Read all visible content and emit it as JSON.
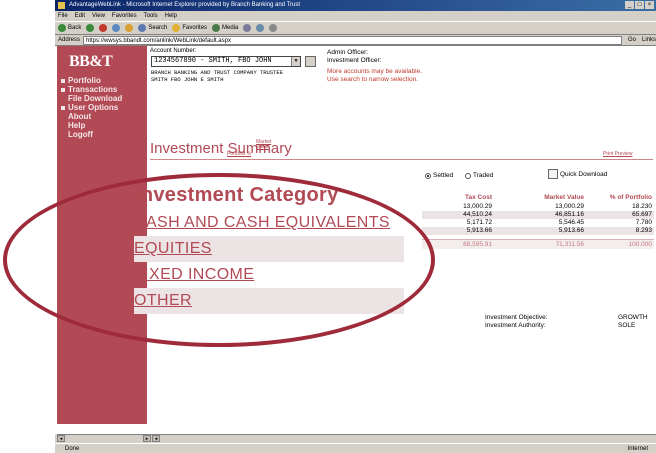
{
  "window": {
    "title": "AdvantageWebLink - Microsoft Internet Explorer provided by Branch Banking and Trust"
  },
  "menu": [
    "File",
    "Edit",
    "View",
    "Favorites",
    "Tools",
    "Help"
  ],
  "toolbar": {
    "back": "Back",
    "search": "Search",
    "favorites": "Favorites",
    "media": "Media"
  },
  "address": {
    "label": "Address",
    "url": "https://wwsys.bbandt.com/anlink/WebLink/default.aspx",
    "go": "Go",
    "links": "Links"
  },
  "sidebar": {
    "logo": "BB&T",
    "items": [
      {
        "label": "Portfolio",
        "bullet": true
      },
      {
        "label": "Transactions",
        "bullet": true
      },
      {
        "label": "File Download",
        "bullet": false
      },
      {
        "label": "User Options",
        "bullet": true
      },
      {
        "label": "About",
        "bullet": false
      },
      {
        "label": "Help",
        "bullet": false
      },
      {
        "label": "Logoff",
        "bullet": false
      }
    ]
  },
  "account": {
    "label": "Account Number:",
    "selected": "1234567890 - SMITH, FBO JOHN",
    "trustee_line1": "BRANCH BANKING AND TRUST COMPANY TRUSTEE",
    "trustee_line2": "SMITH FBO JOHN E SMITH",
    "admin_officer": "Admin Officer:",
    "investment_officer": "Investment Officer:",
    "notice_line1": "More accounts may be available.",
    "notice_line2": "Use search to narrow selection."
  },
  "summary": {
    "title": "Investment Summary",
    "link_portfolio": "Portfolio %",
    "link_market": "Market Value",
    "link_print": "Print Preview",
    "radio_settled": "Settled",
    "radio_traded": "Traded",
    "quick_download": "Quick Download",
    "category_heading": "Investment Category",
    "categories": [
      "CASH AND CASH EQUIVALENTS",
      "EQUITIES",
      "FIXED INCOME",
      "OTHER"
    ],
    "columns": [
      "Tax Cost",
      "Market Value",
      "% of Portfolio"
    ],
    "rows": [
      [
        "13,000.29",
        "13,000.29",
        "18.230"
      ],
      [
        "44,510.24",
        "46,851.16",
        "65.697"
      ],
      [
        "5,171.72",
        "5,546.45",
        "7.780"
      ],
      [
        "5,913.66",
        "5,913.66",
        "8.293"
      ]
    ],
    "totals": [
      "68,595.91",
      "71,311.56",
      "100.000"
    ],
    "objective_label": "Investment Objective:",
    "objective_value": "GROWTH",
    "authority_label": "Investment Authority:",
    "authority_value": "SOLE"
  },
  "status": {
    "left": "Done",
    "right": "Internet"
  },
  "colors": {
    "brand": "#b24a55",
    "highlight": "#9e2a3a"
  }
}
